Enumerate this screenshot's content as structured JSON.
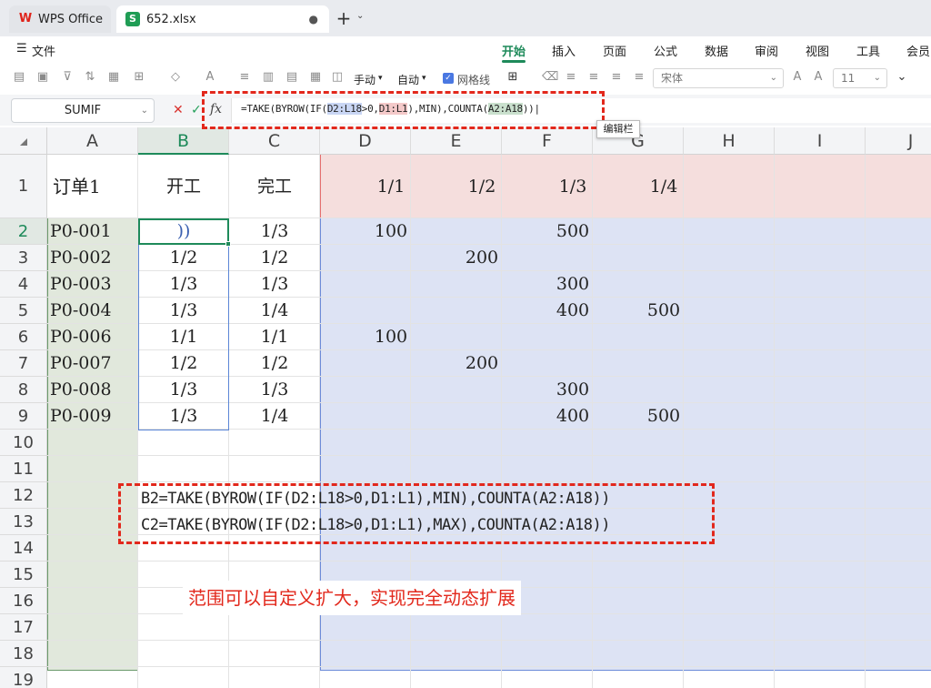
{
  "tabs": {
    "home": "WPS Office",
    "file": "652.xlsx",
    "file_badge": "S",
    "dot": "●",
    "new_tab": "+",
    "tab_menu": "⌄"
  },
  "menu": {
    "file": "文件",
    "items": [
      "开始",
      "插入",
      "页面",
      "公式",
      "数据",
      "审阅",
      "视图",
      "工具",
      "会员"
    ],
    "active": "开始"
  },
  "toolbar": {
    "manual": "手动",
    "auto": "自动",
    "gridlines": "网格线",
    "gridlines_checked": true,
    "font": "宋体",
    "size": "11"
  },
  "formula_bar": {
    "name_box": "SUMIF",
    "fx": "fx",
    "cancel": "✕",
    "ok": "✓",
    "f_prefix": "=TAKE(BYROW(IF(",
    "f_ref1": "D2:L18",
    "f_mid1": ">0,",
    "f_ref2": "D1:L1",
    "f_mid2": "),MIN),COUNTA(",
    "f_ref3": "A2:A18",
    "f_suffix": "))|",
    "tooltip": "编辑栏"
  },
  "grid": {
    "columns": [
      "A",
      "B",
      "C",
      "D",
      "E",
      "F",
      "G",
      "H",
      "I",
      "J"
    ],
    "selected_column": "B",
    "selected_row": "2",
    "rows": [
      "1",
      "2",
      "3",
      "4",
      "5",
      "6",
      "7",
      "8",
      "9",
      "10",
      "11",
      "12",
      "13",
      "14",
      "15",
      "16",
      "17",
      "18",
      "19"
    ],
    "header": {
      "A": "订单1",
      "B": "开工",
      "C": "完工",
      "D": "1/1",
      "E": "1/2",
      "F": "1/3",
      "G": "1/4"
    },
    "data": [
      {
        "A": "P0-001",
        "B": "))",
        "C": "1/3",
        "D": "100",
        "E": "",
        "F": "500",
        "G": ""
      },
      {
        "A": "P0-002",
        "B": "1/2",
        "C": "1/2",
        "D": "",
        "E": "200",
        "F": "",
        "G": ""
      },
      {
        "A": "P0-003",
        "B": "1/3",
        "C": "1/3",
        "D": "",
        "E": "",
        "F": "300",
        "G": ""
      },
      {
        "A": "P0-004",
        "B": "1/3",
        "C": "1/4",
        "D": "",
        "E": "",
        "F": "400",
        "G": "500"
      },
      {
        "A": "P0-006",
        "B": "1/1",
        "C": "1/1",
        "D": "100",
        "E": "",
        "F": "",
        "G": ""
      },
      {
        "A": "P0-007",
        "B": "1/2",
        "C": "1/2",
        "D": "",
        "E": "200",
        "F": "",
        "G": ""
      },
      {
        "A": "P0-008",
        "B": "1/3",
        "C": "1/3",
        "D": "",
        "E": "",
        "F": "300",
        "G": ""
      },
      {
        "A": "P0-009",
        "B": "1/3",
        "C": "1/4",
        "D": "",
        "E": "",
        "F": "400",
        "G": "500"
      }
    ]
  },
  "notes": {
    "line1": "B2=TAKE(BYROW(IF(D2:L18>0,D1:L1),MIN),COUNTA(A2:A18))",
    "line2": "C2=TAKE(BYROW(IF(D2:L18>0,D1:L1),MAX),COUNTA(A2:A18))",
    "red_note": "范围可以自定义扩大，实现完全动态扩展"
  },
  "colors": {
    "accent": "#1e8a5a",
    "annotation": "#e2281c",
    "ref_blue": "#dde3f4",
    "ref_red": "#f5dedd",
    "ref_green": "#e1e8dc"
  }
}
